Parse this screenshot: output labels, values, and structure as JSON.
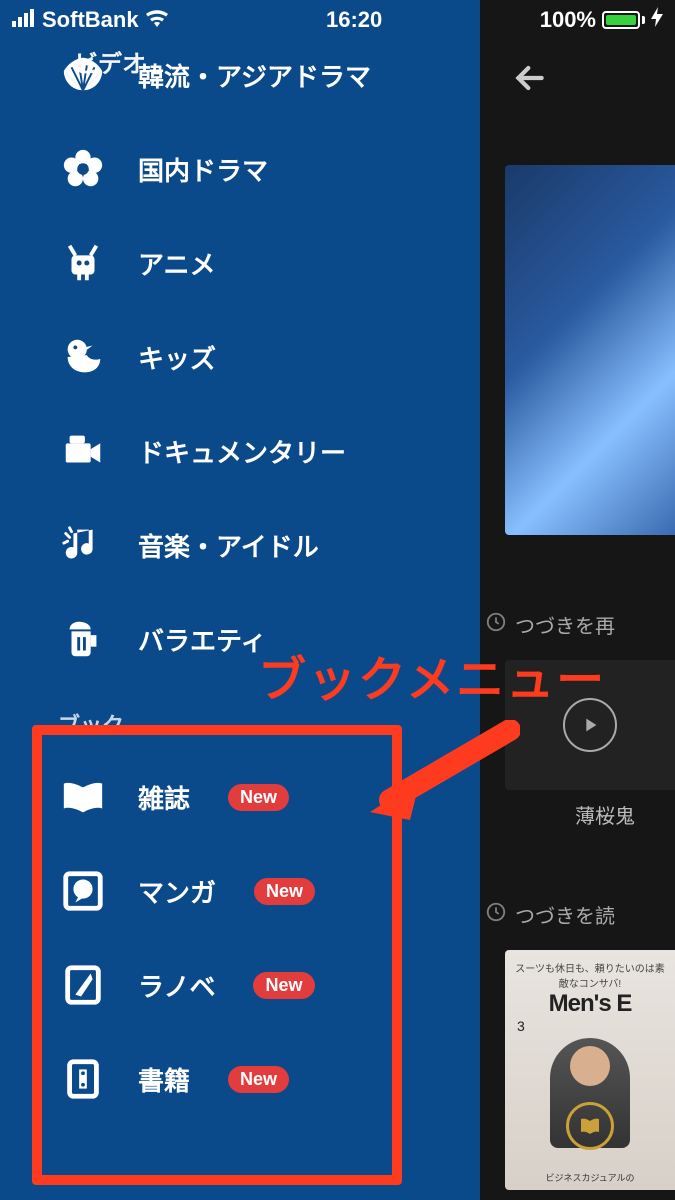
{
  "status": {
    "carrier": "SoftBank",
    "time": "16:20",
    "battery_pct": "100%"
  },
  "sidebar": {
    "top_label": "ビデオ",
    "video_items": [
      {
        "label": "韓流・アジアドラマ"
      },
      {
        "label": "国内ドラマ"
      },
      {
        "label": "アニメ"
      },
      {
        "label": "キッズ"
      },
      {
        "label": "ドキュメンタリー"
      },
      {
        "label": "音楽・アイドル"
      },
      {
        "label": "バラエティ"
      }
    ],
    "book_section_header": "ブック",
    "book_items": [
      {
        "label": "雑誌",
        "badge": "New"
      },
      {
        "label": "マンガ",
        "badge": "New"
      },
      {
        "label": "ラノベ",
        "badge": "New"
      },
      {
        "label": "書籍",
        "badge": "New"
      }
    ]
  },
  "background": {
    "continue_watch": "つづきを再",
    "caption1": "薄桜鬼",
    "continue_read": "つづきを読",
    "magazine": {
      "tag": "スーツも休日も、頼りたいのは素敵なコンサバ!",
      "title": "Men's E",
      "issue": "3",
      "sub": "ビジネスカジュアルの"
    }
  },
  "annotation": {
    "label": "ブックメニュー"
  }
}
